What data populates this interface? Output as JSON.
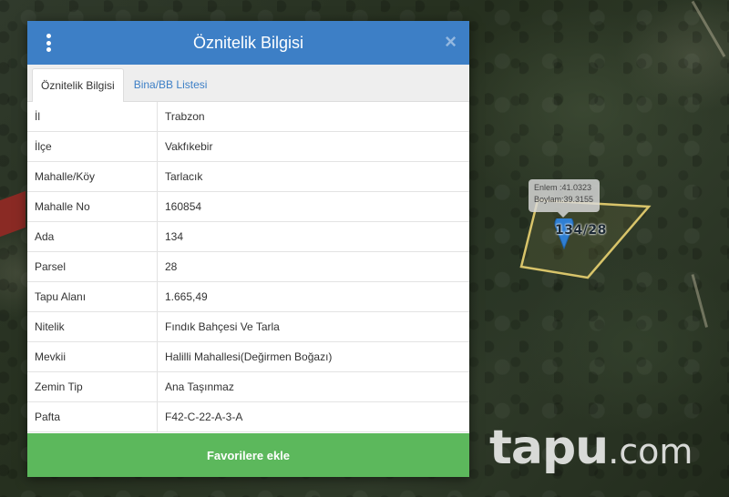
{
  "dialog": {
    "title": "Öznitelik Bilgisi",
    "close_glyph": "×",
    "tabs": [
      {
        "label": "Öznitelik Bilgisi",
        "active": true
      },
      {
        "label": "Bina/BB Listesi",
        "active": false
      }
    ],
    "rows": [
      {
        "key": "İl",
        "value": "Trabzon"
      },
      {
        "key": "İlçe",
        "value": "Vakfıkebir"
      },
      {
        "key": "Mahalle/Köy",
        "value": "Tarlacık"
      },
      {
        "key": "Mahalle No",
        "value": "160854"
      },
      {
        "key": "Ada",
        "value": "134"
      },
      {
        "key": "Parsel",
        "value": "28"
      },
      {
        "key": "Tapu Alanı",
        "value": "1.665,49"
      },
      {
        "key": "Nitelik",
        "value": "Fındık Bahçesi Ve Tarla"
      },
      {
        "key": "Mevkii",
        "value": "Halilli Mahallesi(Değirmen Boğazı)"
      },
      {
        "key": "Zemin Tip",
        "value": "Ana Taşınmaz"
      },
      {
        "key": "Pafta",
        "value": "F42-C-22-A-3-A"
      }
    ],
    "favorite_button": "Favorilere ekle"
  },
  "map": {
    "tooltip_lat": "Enlem :41.0323",
    "tooltip_lon": "Boylam:39.3155",
    "parcel_label": "134/28"
  },
  "watermark": {
    "main": "tapu",
    "suffix": ".com"
  },
  "colors": {
    "header_blue": "#3d7fc6",
    "button_green": "#5cb85c",
    "parcel_outline": "#d8c46a",
    "pin_blue": "#2f7fd3"
  },
  "icons": {
    "menu": "vertical-dots-icon",
    "close": "close-icon",
    "pin": "map-pin-icon"
  }
}
